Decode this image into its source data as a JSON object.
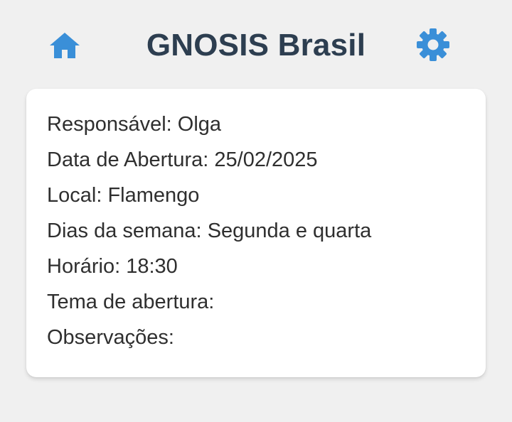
{
  "header": {
    "title": "GNOSIS Brasil",
    "home_icon": "home-icon",
    "settings_icon": "gear-icon",
    "accent_color": "#3a8fd8",
    "title_color": "#2d3e50"
  },
  "details": {
    "rows": [
      {
        "label": "Responsável:",
        "value": "Olga"
      },
      {
        "label": "Data de Abertura:",
        "value": "25/02/2025"
      },
      {
        "label": "Local:",
        "value": "Flamengo"
      },
      {
        "label": "Dias da semana:",
        "value": "Segunda e quarta"
      },
      {
        "label": "Horário:",
        "value": "18:30"
      },
      {
        "label": "Tema de abertura:",
        "value": ""
      },
      {
        "label": "Observações:",
        "value": ""
      }
    ]
  }
}
